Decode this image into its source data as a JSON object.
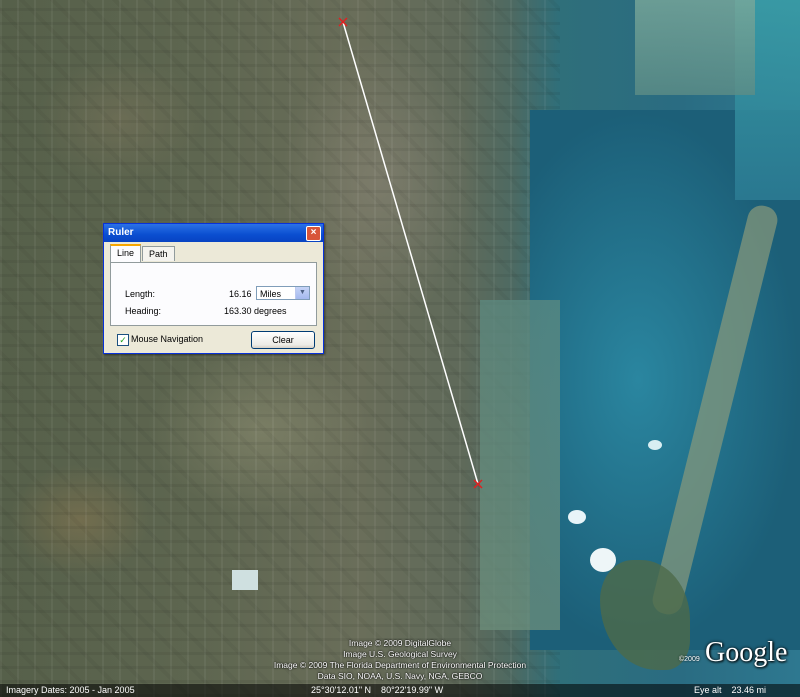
{
  "ruler": {
    "title": "Ruler",
    "close_glyph": "×",
    "tabs": [
      {
        "label": "Line"
      },
      {
        "label": "Path"
      }
    ],
    "length_label": "Length:",
    "length_value": "16.16",
    "unit": "Miles",
    "heading_label": "Heading:",
    "heading_value": "163.30 degrees",
    "mouse_navigation_label": "Mouse Navigation",
    "mouse_navigation_checked": true,
    "clear_label": "Clear"
  },
  "attribution": {
    "line1": "Image © 2009 DigitalGlobe",
    "line2": "Image U.S. Geological Survey",
    "line3": "Image © 2009 The Florida Department of Environmental Protection",
    "line4": "Data SIO, NOAA, U.S. Navy, NGA, GEBCO"
  },
  "logo": {
    "text": "Google",
    "copyright": "©2009"
  },
  "footer": {
    "imagery_dates": "Imagery Dates: 2005 - Jan 2005",
    "coordinates": "25°30'12.01\" N    80°22'19.99\" W",
    "eye_alt": "Eye alt    23.46 mi"
  },
  "colors": {
    "ruler_line": "#ffffff",
    "placemark": "#e02020",
    "title_bar": "#0a4ed0"
  }
}
